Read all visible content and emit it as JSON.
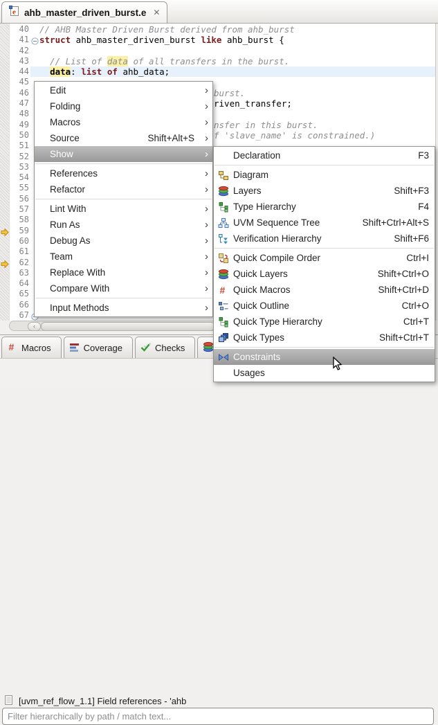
{
  "window": {
    "tab_title": "ahb_master_driven_burst.e",
    "close_glyph": "✕"
  },
  "editor": {
    "lines": [
      {
        "num": "40",
        "segments": [
          [
            "c",
            "// AHB Master Driven Burst derived from ahb_burst"
          ]
        ]
      },
      {
        "num": "41",
        "fold": true,
        "segments": [
          [
            "k",
            "struct"
          ],
          [
            "p",
            " ahb_master_driven_burst "
          ],
          [
            "k",
            "like"
          ],
          [
            "p",
            " ahb_burst {"
          ]
        ]
      },
      {
        "num": "42",
        "segments": []
      },
      {
        "num": "43",
        "segments": [
          [
            "c",
            "  // List of "
          ],
          [
            "ch",
            "data"
          ],
          [
            "c",
            " of all transfers in the burst."
          ]
        ]
      },
      {
        "num": "44",
        "current": true,
        "segments": [
          [
            "p",
            "  "
          ],
          [
            "hb",
            "data"
          ],
          [
            "p",
            ": "
          ],
          [
            "k",
            "list of"
          ],
          [
            "p",
            " ahb_data;"
          ]
        ]
      },
      {
        "num": "45",
        "segments": []
      },
      {
        "num": "46",
        "pad": 252,
        "segments": [
          [
            "c",
            "burst."
          ]
        ]
      },
      {
        "num": "47",
        "pad": 252,
        "segments": [
          [
            "p",
            "riven_transfer;"
          ]
        ]
      },
      {
        "num": "48",
        "segments": []
      },
      {
        "num": "49",
        "pad": 252,
        "segments": [
          [
            "c",
            "nsfer in this burst."
          ]
        ]
      },
      {
        "num": "50",
        "pad": 252,
        "segments": [
          [
            "c",
            "f 'slave_name' is constrained.)"
          ]
        ]
      },
      {
        "num": "51",
        "segments": []
      },
      {
        "num": "52",
        "segments": []
      },
      {
        "num": "53",
        "segments": []
      },
      {
        "num": "54",
        "segments": []
      },
      {
        "num": "55",
        "segments": []
      },
      {
        "num": "56",
        "segments": []
      },
      {
        "num": "57",
        "segments": []
      },
      {
        "num": "58",
        "segments": []
      },
      {
        "num": "59",
        "marker": "arrow",
        "segments": []
      },
      {
        "num": "60",
        "segments": []
      },
      {
        "num": "61",
        "segments": []
      },
      {
        "num": "62",
        "marker": "arrow",
        "segments": []
      },
      {
        "num": "63",
        "segments": []
      },
      {
        "num": "64",
        "segments": []
      },
      {
        "num": "65",
        "segments": []
      },
      {
        "num": "66",
        "segments": []
      },
      {
        "num": "67",
        "fold": true,
        "segments": []
      }
    ]
  },
  "menus": {
    "arrow_glyph": "›",
    "context": {
      "items": [
        {
          "label": "Edit",
          "submenu": true
        },
        {
          "label": "Folding",
          "submenu": true
        },
        {
          "label": "Macros",
          "submenu": true
        },
        {
          "label": "Source",
          "shortcut": "Shift+Alt+S",
          "submenu": true
        },
        {
          "label": "Show",
          "submenu": true,
          "highlighted": true,
          "separator_after": true
        },
        {
          "label": "References",
          "submenu": true
        },
        {
          "label": "Refactor",
          "submenu": true,
          "separator_after": true
        },
        {
          "label": "Lint With",
          "submenu": true
        },
        {
          "label": "Run As",
          "submenu": true
        },
        {
          "label": "Debug As",
          "submenu": true
        },
        {
          "label": "Team",
          "submenu": true
        },
        {
          "label": "Replace With",
          "submenu": true
        },
        {
          "label": "Compare With",
          "submenu": true,
          "separator_after": true
        },
        {
          "label": "Input Methods",
          "submenu": true
        }
      ]
    },
    "show_submenu": {
      "items": [
        {
          "label": "Declaration",
          "shortcut": "F3",
          "separator_after": true
        },
        {
          "icon": "diagram",
          "label": "Diagram"
        },
        {
          "icon": "layers",
          "label": "Layers",
          "shortcut": "Shift+F3"
        },
        {
          "icon": "type-hierarchy",
          "label": "Type Hierarchy",
          "shortcut": "F4"
        },
        {
          "icon": "uvm-sequence-tree",
          "label": "UVM Sequence Tree",
          "shortcut": "Shift+Ctrl+Alt+S"
        },
        {
          "icon": "verification-hierarchy",
          "label": "Verification Hierarchy",
          "shortcut": "Shift+F6",
          "separator_after": true
        },
        {
          "icon": "compile-order",
          "label": "Quick Compile Order",
          "shortcut": "Ctrl+I"
        },
        {
          "icon": "layers",
          "label": "Quick Layers",
          "shortcut": "Shift+Ctrl+O"
        },
        {
          "icon": "macro-hash",
          "label": "Quick Macros",
          "shortcut": "Shift+Ctrl+D"
        },
        {
          "icon": "outline",
          "label": "Quick Outline",
          "shortcut": "Ctrl+O"
        },
        {
          "icon": "type-hierarchy",
          "label": "Quick Type Hierarchy",
          "shortcut": "Ctrl+T"
        },
        {
          "icon": "quick-types",
          "label": "Quick Types",
          "shortcut": "Shift+Ctrl+T",
          "separator_after": true
        },
        {
          "icon": "constraints",
          "label": "Constraints",
          "highlighted": true
        },
        {
          "label": "Usages"
        }
      ]
    }
  },
  "bottom_panel": {
    "tabs": [
      {
        "icon": "macro-hash",
        "label": "Macros"
      },
      {
        "icon": "coverage",
        "label": "Coverage"
      },
      {
        "icon": "checks",
        "label": "Checks"
      },
      {
        "icon": "layers",
        "label": "Layers"
      }
    ],
    "status_text": "[uvm_ref_flow_1.1] Field references - 'ahb",
    "filter_placeholder": "Filter hierarchically by path / match text..."
  },
  "colors": {
    "keyword": "#7a1c1c",
    "comment": "#8e8e8e",
    "occurrence_highlight": "#fbf0a3",
    "current_line": "#e7f1fb",
    "menu_highlight_top": "#bdbdbd",
    "menu_highlight_bottom": "#999999"
  }
}
